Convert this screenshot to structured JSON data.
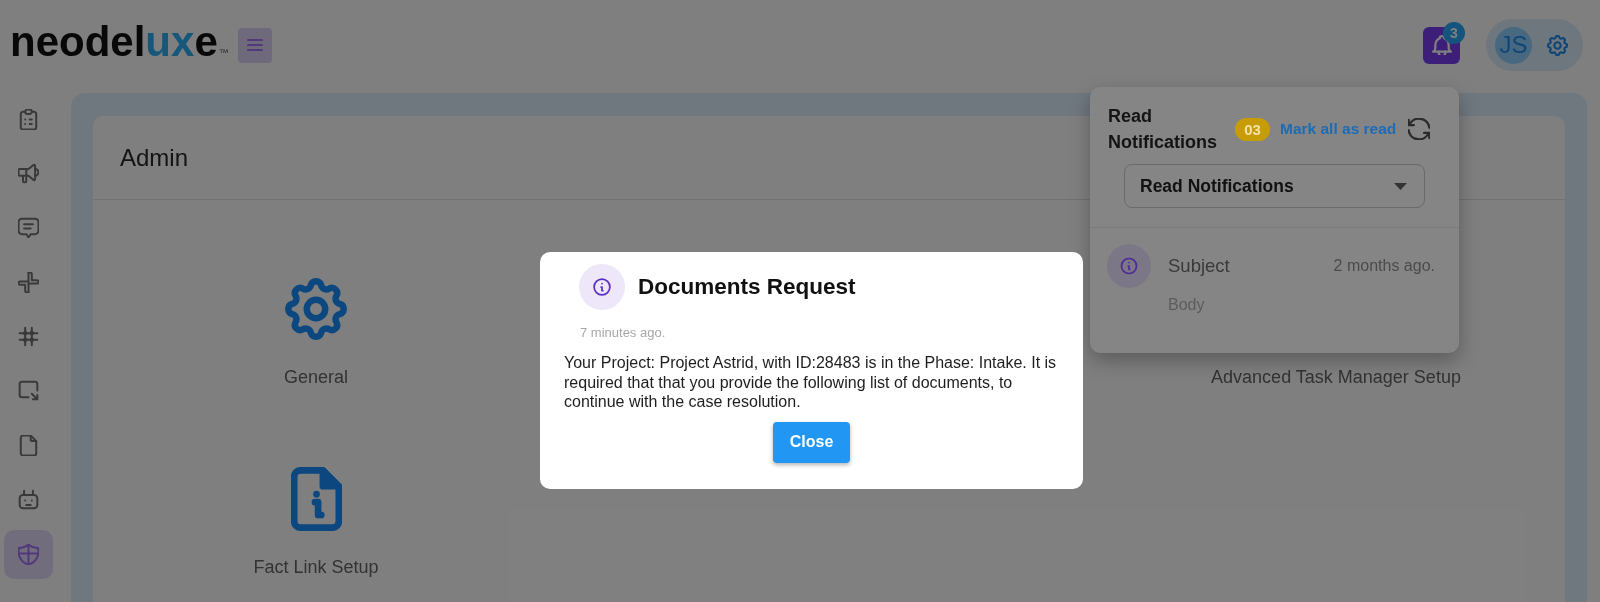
{
  "header": {
    "logo": {
      "parts": [
        {
          "text": "neodel",
          "accent": false
        },
        {
          "text": "ux",
          "accent": true
        },
        {
          "text": "e",
          "accent": false
        }
      ],
      "trademark": "™"
    },
    "notification_count": "3",
    "user_initials": "JS"
  },
  "sidebar": {
    "items": [
      {
        "selected": false
      },
      {
        "selected": false
      },
      {
        "selected": false
      },
      {
        "selected": false
      },
      {
        "selected": false
      },
      {
        "selected": false
      },
      {
        "selected": false
      },
      {
        "selected": false
      },
      {
        "selected": true
      }
    ]
  },
  "page": {
    "title": "Admin",
    "tiles": [
      {
        "label": "General"
      },
      {
        "label": "Advanced Task Manager Setup"
      },
      {
        "label": "Fact Link Setup"
      }
    ]
  },
  "notifications_panel": {
    "title": "Read Notifications",
    "count": "03",
    "mark_all_link": "Mark all as read",
    "filter": {
      "value": "Read Notifications"
    },
    "items": [
      {
        "subject": "Subject",
        "time": "2 months ago.",
        "body": "Body"
      }
    ]
  },
  "modal": {
    "title": "Documents Request",
    "time": "7 minutes ago.",
    "message": "Your Project: Project Astrid, with ID:28483 is in the Phase: Intake. It is required that that you provide the following list of documents, to continue with the case resolution.",
    "close_button": "Close"
  }
}
